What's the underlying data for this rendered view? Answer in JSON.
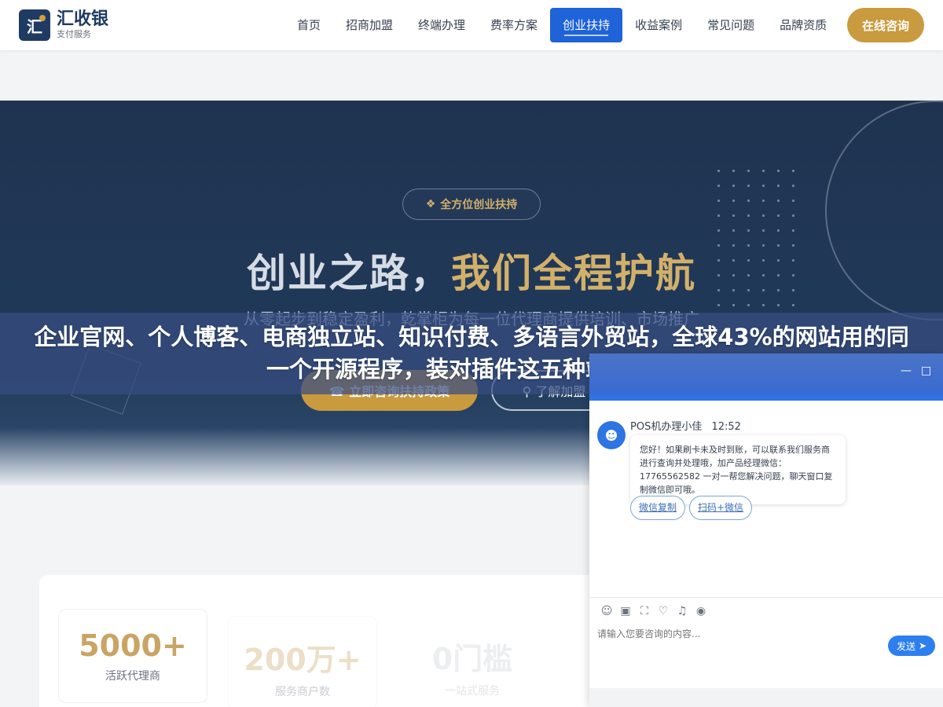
{
  "header": {
    "logo_mark": "汇",
    "logo_name": "汇收银",
    "logo_sub": "支付服务",
    "nav": [
      {
        "label": "首页"
      },
      {
        "label": "招商加盟"
      },
      {
        "label": "终端办理"
      },
      {
        "label": "费率方案"
      },
      {
        "label": "创业扶持"
      },
      {
        "label": "收益案例"
      },
      {
        "label": "常见问题"
      },
      {
        "label": "品牌资质"
      }
    ],
    "consult_label": "在线咨询"
  },
  "hero": {
    "badge": "全方位创业扶持",
    "title_part1": "创业之路，",
    "title_part2": "我们全程护航",
    "subtitle": "从零起步到稳定盈利，乾掌柜为每一位代理商提供培训、市场推广",
    "btn_primary": "立即咨询扶持政策",
    "btn_secondary": "了解加盟"
  },
  "overlay": {
    "text": "企业官网、个人博客、电商独立站、知识付费、多语言外贸站，全球43%的网站用的同一个开源程序，装对插件这五种站都能做"
  },
  "stats": [
    {
      "value": "5000+",
      "label": "活跃代理商"
    },
    {
      "value": "200万+",
      "label": "服务商户数"
    },
    {
      "value": "0门槛",
      "label": "一站式服务"
    }
  ],
  "chat": {
    "agent_name": "POS机办理小佳",
    "time": "12:52",
    "message": "您好！如果刷卡未及时到账，可以联系我们服务商进行查询并处理哦，加产品经理微信：17765562582 一对一帮您解决问题，聊天窗口复制微信即可哦。",
    "chips": [
      {
        "label": "微信复制"
      },
      {
        "label": "扫码+微信"
      }
    ],
    "input_placeholder": "请输入您要咨询的内容...",
    "send_label": "发送"
  },
  "colors": {
    "brand_navy": "#1f3b63",
    "accent_gold": "#c99a3e",
    "nav_active": "#1e63d8",
    "chat_blue": "#2d74e4"
  }
}
